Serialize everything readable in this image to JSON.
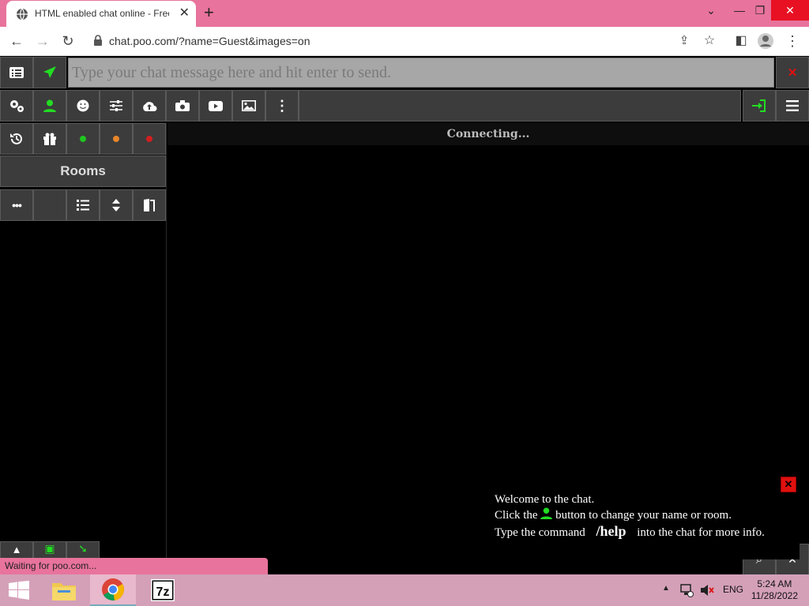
{
  "browser": {
    "tab_title": "HTML enabled chat online - Free",
    "url": "chat.poo.com/?name=Guest&images=on",
    "status_text": "Waiting for poo.com..."
  },
  "chat": {
    "message_placeholder": "Type your chat message here and hit enter to send.",
    "rooms_label": "Rooms",
    "connecting_text": "Connecting...",
    "welcome": {
      "line1": "Welcome to the chat.",
      "line2_before": "Click the",
      "line2_after": "button to change your name or room.",
      "line3_before": "Type the command",
      "command": "/help",
      "line3_after": "into the chat for more info."
    },
    "status_dot_colors": [
      "#1fc41f",
      "#e8862a",
      "#d11f1f"
    ],
    "accent_green": "#22dd22",
    "close_red": "#e01010"
  },
  "taskbar": {
    "language": "ENG",
    "time": "5:24 AM",
    "date": "11/28/2022",
    "apps": [
      "file-explorer-icon",
      "chrome-icon",
      "7zip-icon"
    ]
  }
}
